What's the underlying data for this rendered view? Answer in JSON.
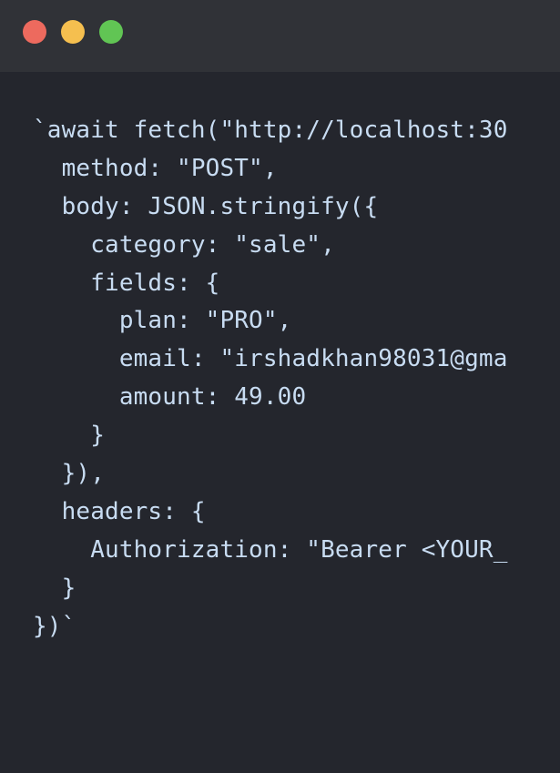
{
  "window": {
    "controls": [
      {
        "name": "close",
        "color": "#ed6a5e"
      },
      {
        "name": "minimize",
        "color": "#f5bf4f"
      },
      {
        "name": "maximize",
        "color": "#61c554"
      }
    ]
  },
  "code": {
    "text_color": "#c8dcf2",
    "lines": [
      "`await fetch(\"http://localhost:30",
      "  method: \"POST\",",
      "  body: JSON.stringify({",
      "    category: \"sale\",",
      "    fields: {",
      "      plan: \"PRO\",",
      "      email: \"irshadkhan98031@gma",
      "      amount: 49.00",
      "    }",
      "  }),",
      "  headers: {",
      "    Authorization: \"Bearer <YOUR_",
      "  }",
      "})`"
    ]
  }
}
